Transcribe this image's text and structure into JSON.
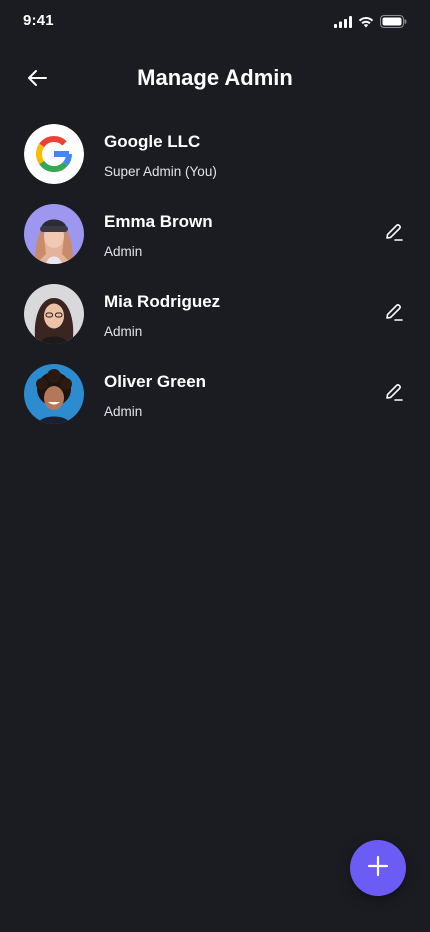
{
  "status_bar": {
    "time": "9:41",
    "icons": [
      "signal-icon",
      "wifi-icon",
      "battery-icon"
    ]
  },
  "header": {
    "title": "Manage Admin",
    "back_icon": "arrow-left-icon"
  },
  "admins": [
    {
      "name": "Google LLC",
      "role": "Super Admin (You)",
      "avatar": "google-logo",
      "editable": false
    },
    {
      "name": "Emma Brown",
      "role": "Admin",
      "avatar": "photo-emma",
      "editable": true
    },
    {
      "name": "Mia Rodriguez",
      "role": "Admin",
      "avatar": "photo-mia",
      "editable": true
    },
    {
      "name": "Oliver Green",
      "role": "Admin",
      "avatar": "photo-oliver",
      "editable": true
    }
  ],
  "fab": {
    "icon": "plus-icon"
  },
  "colors": {
    "background": "#1b1c22",
    "accent": "#6b5cf6",
    "text": "#ffffff"
  }
}
